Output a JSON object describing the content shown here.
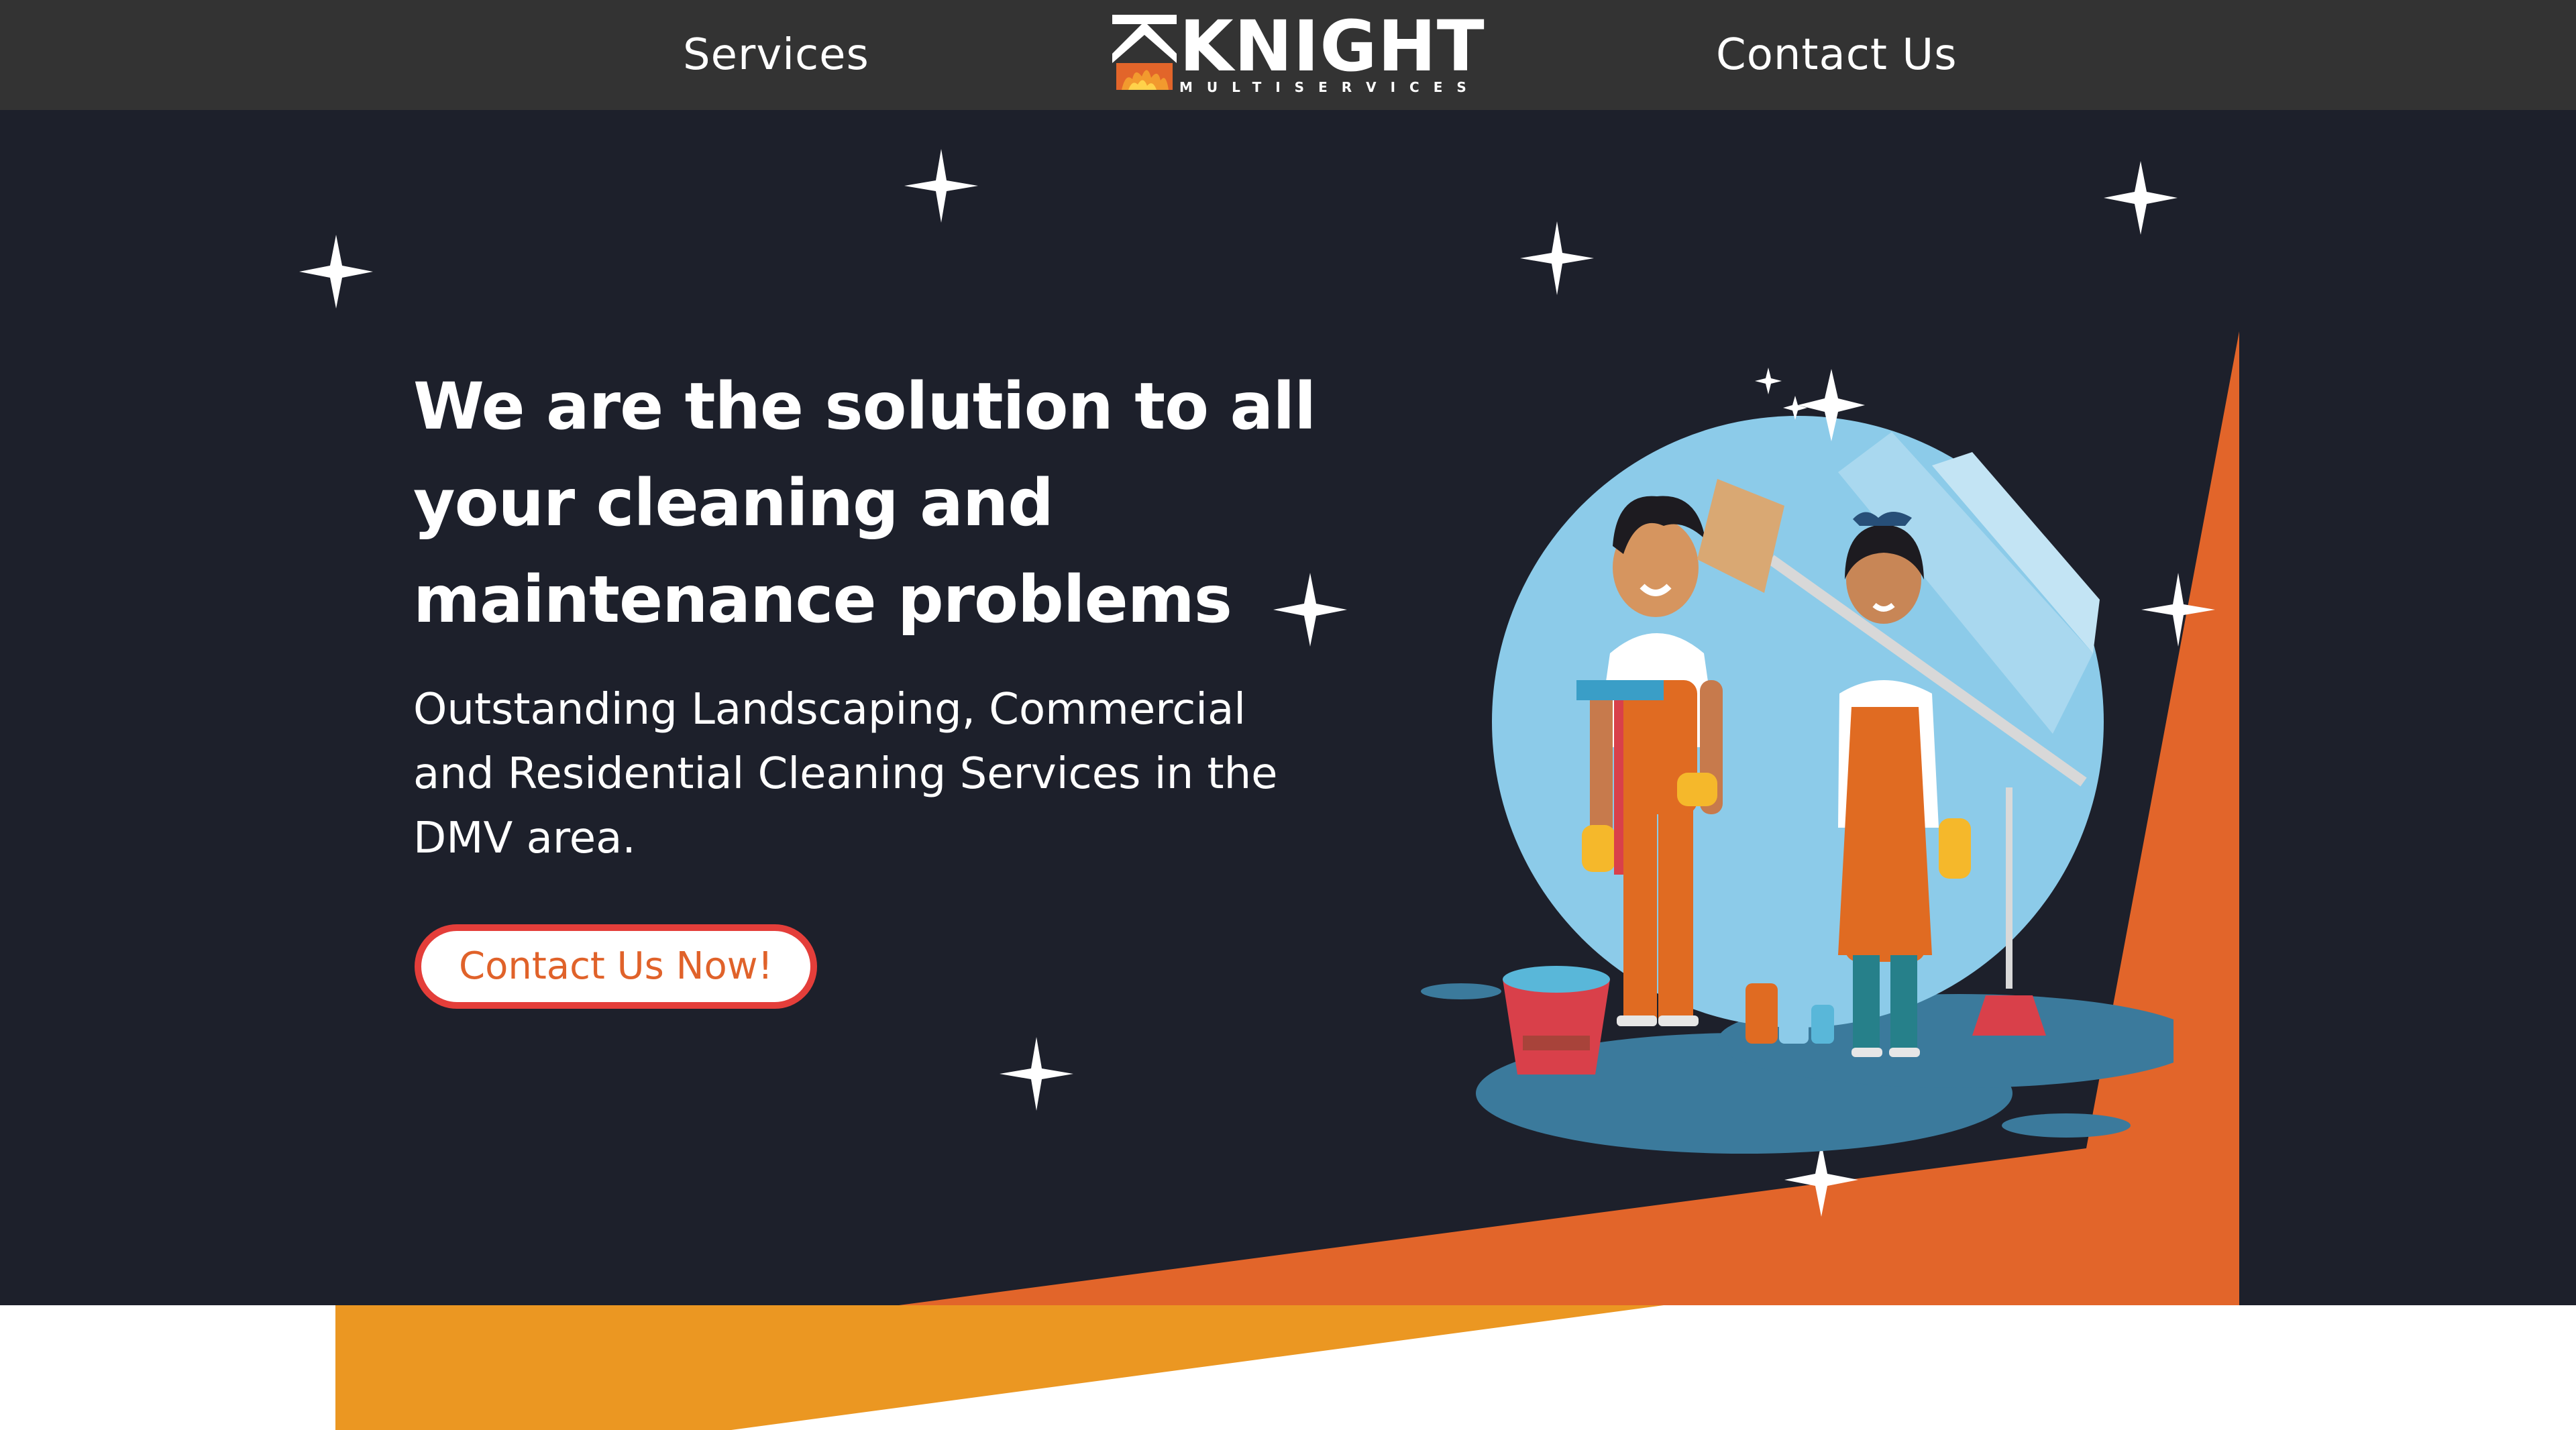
{
  "nav": {
    "services_label": "Services",
    "contact_label": "Contact Us",
    "logo": {
      "name": "KNIGHT",
      "tagline": "MULTISERVICES"
    }
  },
  "hero": {
    "heading": "We are the solution to all your cleaning and maintenance problems",
    "subheading": "Outstanding Landscaping, Commercial and Residential Cleaning Services in the DMV area.",
    "cta_label": "Contact Us Now!"
  },
  "icons": {
    "logo_mark": "house-flame-logo-icon",
    "decoration": "sparkle-star-icon",
    "illustration": "cleaning-staff-illustration"
  },
  "colors": {
    "nav_bg": "#333333",
    "hero_bg": "#1d202b",
    "accent_orange": "#e2652a",
    "accent_yellow": "#eb9722",
    "cta_border": "#e43e3a",
    "cta_text": "#e0622a"
  }
}
